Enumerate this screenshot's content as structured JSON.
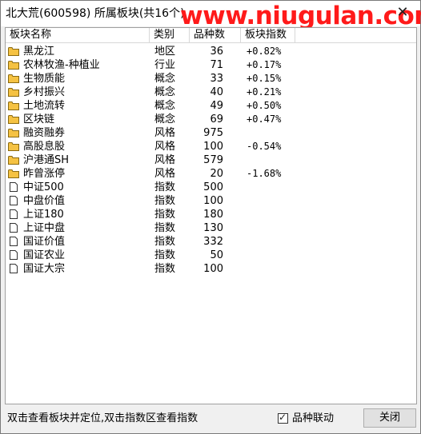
{
  "window": {
    "title": "北大荒(600598) 所属板块(共16个)",
    "watermark": "www.niugulan.com",
    "close_glyph": "✕"
  },
  "table": {
    "columns": [
      "板块名称",
      "类别",
      "品种数",
      "板块指数"
    ],
    "rows": [
      {
        "name": "黑龙江",
        "type": "地区",
        "count": "36",
        "index": "+0.82%",
        "icon": "folder-icon"
      },
      {
        "name": "农林牧渔-种植业",
        "type": "行业",
        "count": "71",
        "index": "+0.17%",
        "icon": "folder-icon"
      },
      {
        "name": "生物质能",
        "type": "概念",
        "count": "33",
        "index": "+0.15%",
        "icon": "folder-icon"
      },
      {
        "name": "乡村振兴",
        "type": "概念",
        "count": "40",
        "index": "+0.21%",
        "icon": "folder-icon"
      },
      {
        "name": "土地流转",
        "type": "概念",
        "count": "49",
        "index": "+0.50%",
        "icon": "folder-icon"
      },
      {
        "name": "区块链",
        "type": "概念",
        "count": "69",
        "index": "+0.47%",
        "icon": "folder-icon"
      },
      {
        "name": "融资融券",
        "type": "风格",
        "count": "975",
        "index": "",
        "icon": "folder-icon"
      },
      {
        "name": "高股息股",
        "type": "风格",
        "count": "100",
        "index": "-0.54%",
        "icon": "folder-icon"
      },
      {
        "name": "沪港通SH",
        "type": "风格",
        "count": "579",
        "index": "",
        "icon": "folder-icon"
      },
      {
        "name": "昨曾涨停",
        "type": "风格",
        "count": "20",
        "index": "-1.68%",
        "icon": "folder-icon"
      },
      {
        "name": "中证500",
        "type": "指数",
        "count": "500",
        "index": "",
        "icon": "page-icon"
      },
      {
        "name": "中盘价值",
        "type": "指数",
        "count": "100",
        "index": "",
        "icon": "page-icon"
      },
      {
        "name": "上证180",
        "type": "指数",
        "count": "180",
        "index": "",
        "icon": "page-icon"
      },
      {
        "name": "上证中盘",
        "type": "指数",
        "count": "130",
        "index": "",
        "icon": "page-icon"
      },
      {
        "name": "国证价值",
        "type": "指数",
        "count": "332",
        "index": "",
        "icon": "page-icon"
      },
      {
        "name": "国证农业",
        "type": "指数",
        "count": "50",
        "index": "",
        "icon": "page-icon"
      },
      {
        "name": "国证大宗",
        "type": "指数",
        "count": "100",
        "index": "",
        "icon": "page-icon"
      }
    ]
  },
  "footer": {
    "hint": "双击查看板块并定位,双击指数区查看指数",
    "checkbox_label": "品种联动",
    "checkbox_checked": true,
    "close_button": "关闭"
  },
  "colors": {
    "folder": "#f5c242",
    "watermark": "#ff1a1a"
  }
}
